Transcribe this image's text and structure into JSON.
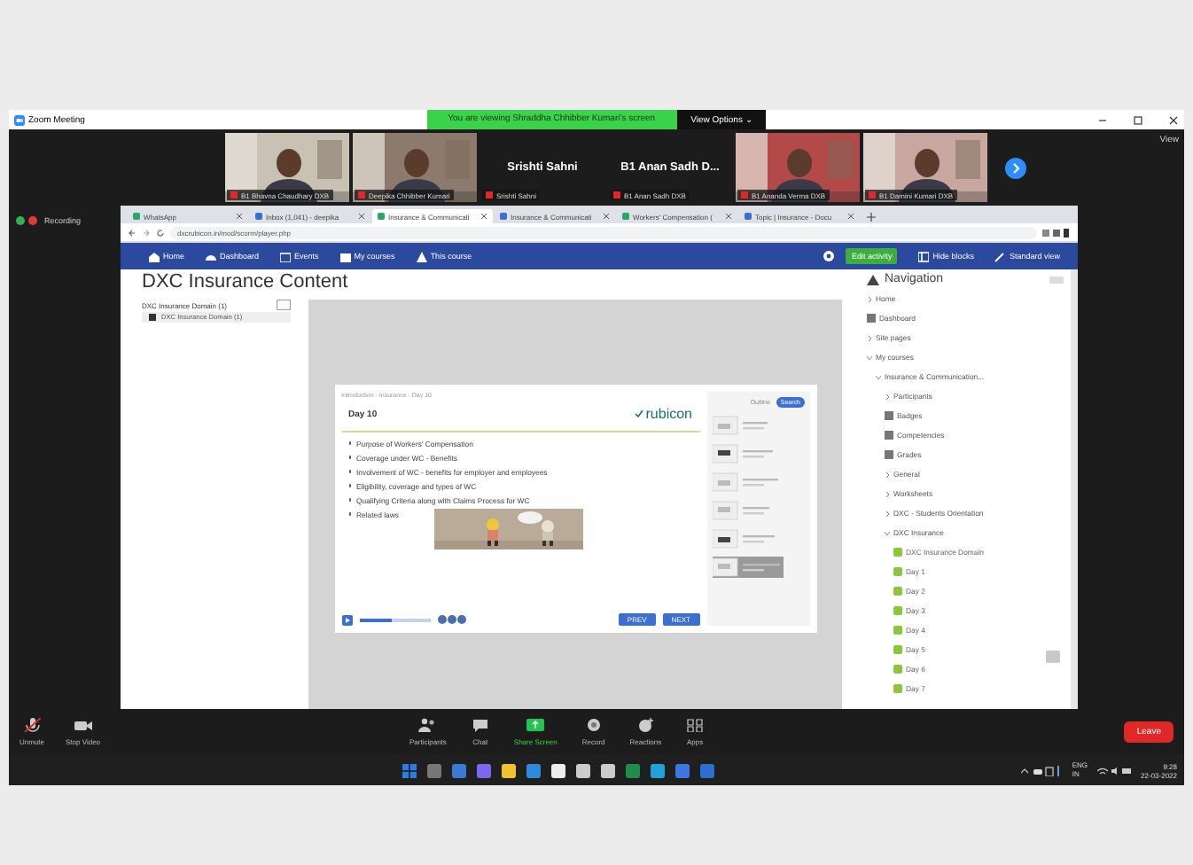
{
  "window": {
    "title": "Zoom Meeting",
    "banner": "You are viewing Shraddha Chhibber Kumari's screen",
    "view_options": "View Options ⌄",
    "view_button": "View"
  },
  "participants": [
    {
      "kind": "video",
      "label": "B1 Bhavna Chaudhary DXB"
    },
    {
      "kind": "video",
      "label": "Deepika Chhibber Kumari"
    },
    {
      "kind": "name",
      "display_name": "Srishti Sahni",
      "label": "Srishti Sahni"
    },
    {
      "kind": "name",
      "display_name": "B1 Anan Sadh D...",
      "label": "B1 Anan Sadh DXB"
    },
    {
      "kind": "video",
      "label": "B1 Ananda Verma DXB"
    },
    {
      "kind": "video",
      "label": "B1 Damini Kumari DXB"
    }
  ],
  "recording": {
    "label": "Recording"
  },
  "browser": {
    "tabs": [
      {
        "label": "WhatsApp",
        "selected": false
      },
      {
        "label": "Inbox (1,041) - deepika",
        "selected": false
      },
      {
        "label": "Insurance & Communicati",
        "selected": true
      },
      {
        "label": "Insurance & Communicati",
        "selected": false
      },
      {
        "label": "Workers' Compensation (",
        "selected": false
      },
      {
        "label": "Topic | Insurance - Docu",
        "selected": false
      }
    ],
    "url": "dxcrubicon.in/mod/scorm/player.php",
    "nav": [
      {
        "label": "Home"
      },
      {
        "label": "Dashboard"
      },
      {
        "label": "Events"
      },
      {
        "label": "My courses"
      },
      {
        "label": "This course"
      }
    ],
    "edit_button": "Edit activity",
    "hide_blocks": "Hide blocks",
    "standard_view": "Standard view"
  },
  "page": {
    "title": "DXC Insurance Content",
    "toc": {
      "title": "DXC Insurance Domain (1)",
      "item": "DXC Insurance Domain (1)"
    },
    "slide": {
      "breadcrumb": "Introduction · Insurance · Day 10",
      "heading": "Day 10",
      "logo": "rubicon",
      "bullets": [
        "Purpose of Workers' Compensation",
        "Coverage under WC - Benefits",
        "Involvement of WC - benefits for employer and employees",
        "Eligibility, coverage and types of WC",
        "Qualifying Criteria along with Claims Process for WC",
        "Related laws"
      ],
      "tabs": [
        {
          "label": "Outline",
          "selected": false
        },
        {
          "label": "Search",
          "selected": true
        }
      ],
      "progress": {
        "level": 0.45
      },
      "prev": "PREV",
      "next": "NEXT"
    },
    "navigation": {
      "title": "Navigation",
      "items": [
        {
          "label": "Home",
          "kind": "node"
        },
        {
          "label": "Dashboard",
          "kind": "icon"
        },
        {
          "label": "Site pages",
          "kind": "node"
        },
        {
          "label": "My courses",
          "kind": "node",
          "children": [
            {
              "label": "Insurance & Communication...",
              "kind": "node",
              "children": [
                {
                  "label": "Participants",
                  "kind": "node"
                },
                {
                  "label": "Badges",
                  "kind": "icon"
                },
                {
                  "label": "Competencies",
                  "kind": "icon"
                },
                {
                  "label": "Grades",
                  "kind": "icon"
                },
                {
                  "label": "General",
                  "kind": "node"
                },
                {
                  "label": "Worksheets",
                  "kind": "node"
                },
                {
                  "label": "DXC - Students Orientation",
                  "kind": "node"
                },
                {
                  "label": "DXC Insurance",
                  "kind": "node",
                  "children": [
                    {
                      "label": "DXC Insurance Domain",
                      "kind": "activity"
                    },
                    {
                      "label": "Day 1",
                      "kind": "activity"
                    },
                    {
                      "label": "Day 2",
                      "kind": "activity"
                    },
                    {
                      "label": "Day 3",
                      "kind": "activity"
                    },
                    {
                      "label": "Day 4",
                      "kind": "activity"
                    },
                    {
                      "label": "Day 5",
                      "kind": "activity"
                    },
                    {
                      "label": "Day 6",
                      "kind": "activity"
                    },
                    {
                      "label": "Day 7",
                      "kind": "activity"
                    }
                  ]
                }
              ]
            }
          ]
        }
      ]
    }
  },
  "toolbar": [
    {
      "label": "Unmute",
      "kind": "mic"
    },
    {
      "label": "Stop Video",
      "kind": "video"
    },
    {
      "label": "Participants",
      "kind": "people"
    },
    {
      "label": "Chat",
      "kind": "chat"
    },
    {
      "label": "Share Screen",
      "kind": "share"
    },
    {
      "label": "Record",
      "kind": "record"
    },
    {
      "label": "Reactions",
      "kind": "react"
    },
    {
      "label": "Apps",
      "kind": "apps"
    }
  ],
  "leave": "Leave",
  "taskbar": {
    "language": "ENG\nIN",
    "time": "9:28",
    "date": "22-03-2022"
  }
}
